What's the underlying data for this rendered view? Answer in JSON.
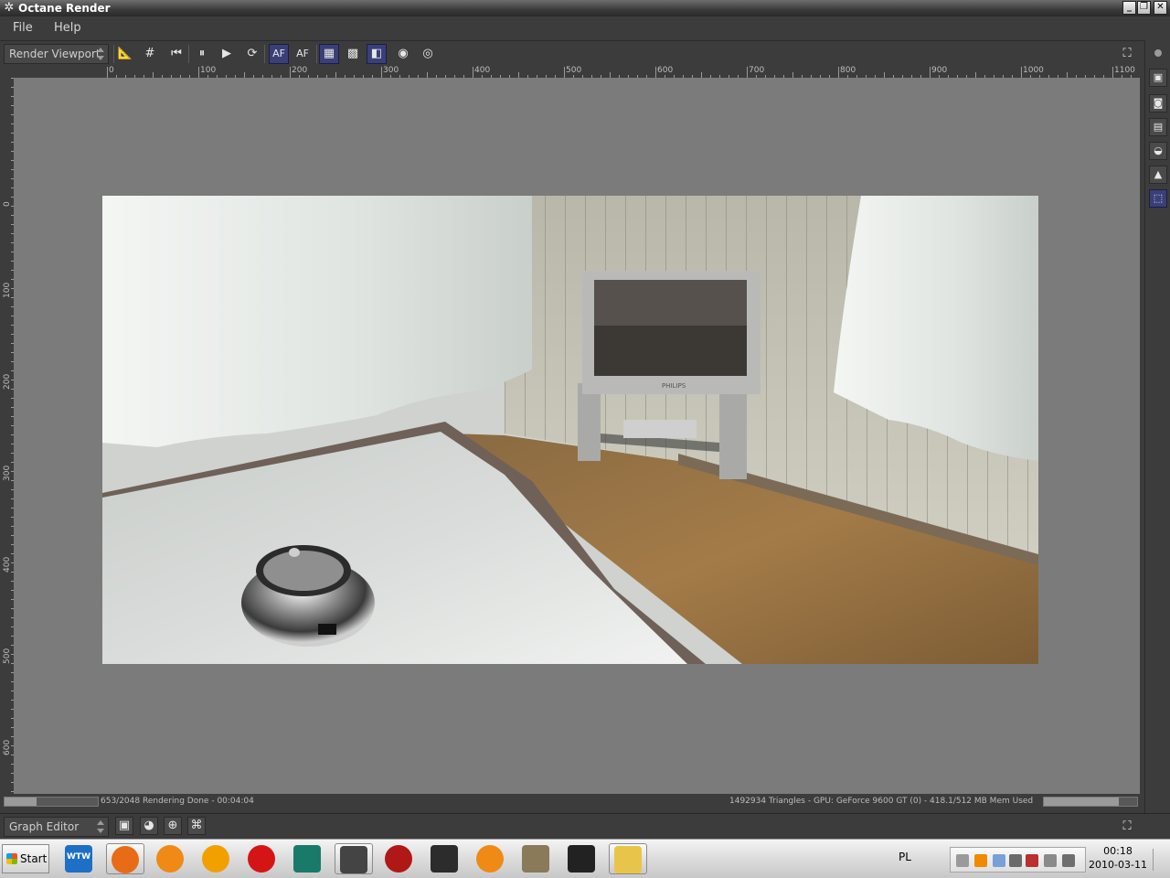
{
  "window": {
    "title": "Octane Render",
    "buttons": {
      "minimize": "_",
      "restore": "❐",
      "close": "✕"
    }
  },
  "menu": {
    "items": [
      {
        "label": "File"
      },
      {
        "label": "Help"
      }
    ]
  },
  "toolbar": {
    "viewport_select": "Render Viewport",
    "buttons": [
      {
        "name": "ruler-toggle-button",
        "icon": "ruler-icon",
        "glyph": "📐",
        "active": false
      },
      {
        "name": "grid-toggle-button",
        "icon": "grid-icon",
        "glyph": "#",
        "active": false
      },
      {
        "name": "restart-button",
        "icon": "skip-back-icon",
        "glyph": "⏮",
        "active": false
      },
      {
        "name": "pause-button",
        "icon": "pause-icon",
        "glyph": "⏸",
        "active": false
      },
      {
        "name": "play-button",
        "icon": "play-icon",
        "glyph": "▶",
        "active": false
      },
      {
        "name": "reset-camera-button",
        "icon": "refresh-icon",
        "glyph": "⟳",
        "active": false
      },
      {
        "name": "autofocus-button",
        "icon": "af-icon",
        "glyph": "AF",
        "active": true
      },
      {
        "name": "autofocus-picker-button",
        "icon": "af-picker-icon",
        "glyph": "AF",
        "active": false
      },
      {
        "name": "alpha-channel-button",
        "icon": "alpha-icon",
        "glyph": "▦",
        "active": true
      },
      {
        "name": "checker-background-button",
        "icon": "checker-icon",
        "glyph": "▩",
        "active": false
      },
      {
        "name": "clay-render-button",
        "icon": "clay-icon",
        "glyph": "◧",
        "active": true
      },
      {
        "name": "pick-material-button",
        "icon": "pick-material-icon",
        "glyph": "◉",
        "active": false
      },
      {
        "name": "pick-object-button",
        "icon": "pick-object-icon",
        "glyph": "◎",
        "active": false
      }
    ],
    "fullscreen_icon": "expand-icon"
  },
  "ruler": {
    "h_labels": [
      "0",
      "100",
      "200",
      "300",
      "400",
      "500",
      "600",
      "700",
      "800",
      "900",
      "1000",
      "1100"
    ],
    "v_labels": [
      "0",
      "100",
      "200",
      "300",
      "400",
      "500",
      "600"
    ]
  },
  "status": {
    "left": "653/2048 Rendering Done - 00:04:04",
    "right": "1492934 Triangles - GPU: GeForce 9600 GT (0) - 418.1/512 MB Mem Used"
  },
  "side_panel": {
    "buttons": [
      {
        "name": "render-target-button",
        "icon": "image-icon",
        "glyph": "▣",
        "active": false
      },
      {
        "name": "camera-settings-button",
        "icon": "camera-icon",
        "glyph": "◙",
        "active": false
      },
      {
        "name": "kernel-settings-button",
        "icon": "settings-icon",
        "glyph": "▤",
        "active": false
      },
      {
        "name": "environment-button",
        "icon": "environment-icon",
        "glyph": "◒",
        "active": false
      },
      {
        "name": "imager-button",
        "icon": "imager-icon",
        "glyph": "▲",
        "active": false
      },
      {
        "name": "node-inspector-button",
        "icon": "node-icon",
        "glyph": "⬚",
        "active": true
      }
    ]
  },
  "graph_editor": {
    "select": "Graph Editor",
    "buttons": [
      {
        "name": "load-material-button",
        "icon": "material-icon",
        "glyph": "▣"
      },
      {
        "name": "texture-button",
        "icon": "texture-icon",
        "glyph": "◕"
      },
      {
        "name": "node-add-button",
        "icon": "node-add-icon",
        "glyph": "⊕"
      },
      {
        "name": "arrange-nodes-button",
        "icon": "arrange-icon",
        "glyph": "⌘"
      }
    ]
  },
  "taskbar": {
    "start_label": "Start",
    "tasks": [
      {
        "name": "wtw-app",
        "icon": "wtw-icon",
        "label": "WTW",
        "color": "#1e6fc6",
        "active": false
      },
      {
        "name": "firefox",
        "icon": "firefox-icon",
        "color": "#e86b16",
        "active": true
      },
      {
        "name": "blender-1",
        "icon": "blender-icon",
        "color": "#ef8a17",
        "active": false
      },
      {
        "name": "vlc-like-app",
        "icon": "cone-icon",
        "color": "#f2a000",
        "active": false
      },
      {
        "name": "opera",
        "icon": "opera-icon",
        "color": "#d51515",
        "active": false
      },
      {
        "name": "app-6",
        "icon": "g-icon",
        "color": "#1a7a6a",
        "active": false
      },
      {
        "name": "octane",
        "icon": "octane-icon",
        "color": "#444444",
        "active": true
      },
      {
        "name": "dragon-app",
        "icon": "dragon-icon",
        "color": "#b01818",
        "active": false
      },
      {
        "name": "counter-strike",
        "icon": "cs-icon",
        "color": "#2c2c2c",
        "active": false
      },
      {
        "name": "blender-2",
        "icon": "blender-icon",
        "color": "#ef8a17",
        "active": false
      },
      {
        "name": "portrait-app",
        "icon": "portrait-icon",
        "color": "#8a7a5a",
        "active": false
      },
      {
        "name": "bird-app",
        "icon": "bird-icon",
        "color": "#222222",
        "active": false
      },
      {
        "name": "explorer",
        "icon": "folder-icon",
        "color": "#e8c44a",
        "active": true
      }
    ],
    "lang": "PL",
    "clock_time": "00:18",
    "clock_date": "2010-03-11"
  }
}
